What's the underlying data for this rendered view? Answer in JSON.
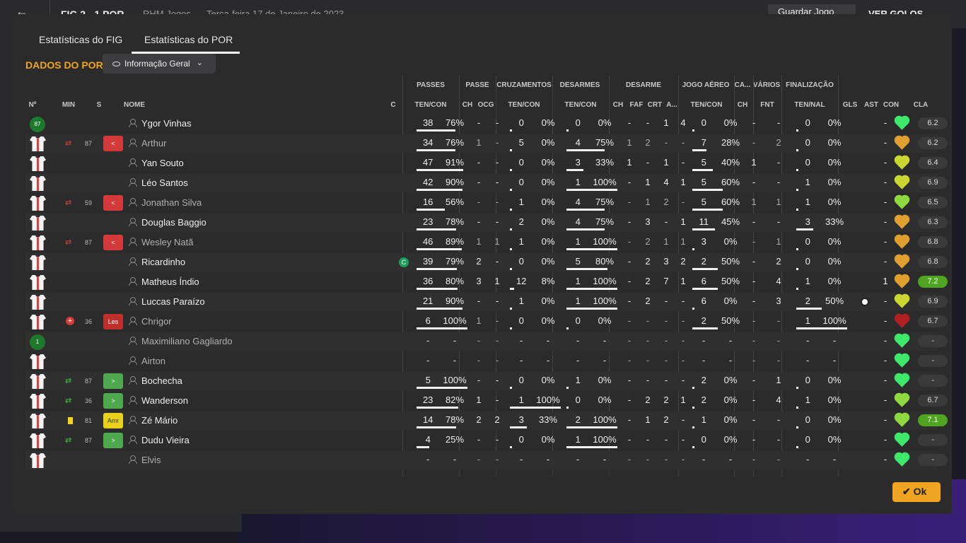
{
  "topbar": {
    "back": "←",
    "score": "FIG  2 - 1  POR",
    "competition": "RHM Jogos",
    "date": "Terça-feira 17 de Janeiro de 2023",
    "save": "Guardar Jogo",
    "goals": "VER GOLOS"
  },
  "tabs": [
    {
      "label": "Estatísticas do FIG"
    },
    {
      "label": "Estatísticas do POR"
    }
  ],
  "title": "DADOS DO POR",
  "dropdown": {
    "label": "Informação Geral"
  },
  "groups": [
    "PASSES",
    "PASSE",
    "CRUZAMENTOS",
    "DESARMES",
    "DESARME",
    "JOGO AÉREO",
    "CA...",
    "VÁRIOS",
    "FINALIZAÇÃO"
  ],
  "cols": {
    "num": "Nº",
    "min": "MIN",
    "s": "S",
    "name": "NOME",
    "c": "C",
    "passes": "TEN/CON",
    "passe_ch": "CH",
    "passe_ocg": "OCG",
    "cruz": "TEN/CON",
    "desarmes": "TEN/CON",
    "des_ch": "CH",
    "des_faf": "FAF",
    "des_crt": "CRT",
    "des_a": "A...",
    "aereo": "TEN/CON",
    "ca_ch": "CH",
    "varios_fnt": "FNT",
    "final": "TEN/NAL",
    "gls": "GLS",
    "ast": "AST",
    "con": "CON",
    "cla": "CLA"
  },
  "players": [
    {
      "shirt": "g",
      "num": "87",
      "sub": "",
      "min": "",
      "badge": "",
      "name": "Ygor Vinhas",
      "dim": false,
      "cap": "",
      "p": [
        "38",
        "76%"
      ],
      "pf": 0.76,
      "ch": "-",
      "ocg": "-",
      "cr": [
        "0",
        "0%"
      ],
      "crf": 0,
      "de": [
        "0",
        "0%"
      ],
      "def": 0,
      "dch": "-",
      "faf": "-",
      "crt": "1",
      "a": "4",
      "ae": [
        "0",
        "0%"
      ],
      "aef": 0,
      "cach": "-",
      "fnt": "-",
      "fi": [
        "0",
        "0%"
      ],
      "fif": 0,
      "gls": "",
      "ast": "-",
      "con": "#3ee86a",
      "cla": "6.2",
      "hi": false
    },
    {
      "shirt": "w",
      "num": "",
      "sub": "out",
      "min": "87",
      "badge": "red",
      "name": "Arthur",
      "dim": true,
      "cap": "",
      "p": [
        "34",
        "76%"
      ],
      "pf": 0.76,
      "ch": "1",
      "ocg": "-",
      "cr": [
        "5",
        "0%"
      ],
      "crf": 0,
      "de": [
        "4",
        "75%"
      ],
      "def": 0.75,
      "dch": "1",
      "faf": "2",
      "crt": "-",
      "a": "-",
      "ae": [
        "7",
        "28%"
      ],
      "aef": 0.28,
      "cach": "-",
      "fnt": "2",
      "fi": [
        "0",
        "0%"
      ],
      "fif": 0,
      "gls": "",
      "ast": "-",
      "con": "#e0a030",
      "cla": "6.2",
      "hi": false
    },
    {
      "shirt": "w",
      "num": "",
      "sub": "",
      "min": "",
      "badge": "",
      "name": "Yan Souto",
      "dim": false,
      "cap": "",
      "p": [
        "47",
        "91%"
      ],
      "pf": 0.91,
      "ch": "-",
      "ocg": "-",
      "cr": [
        "0",
        "0%"
      ],
      "crf": 0,
      "de": [
        "3",
        "33%"
      ],
      "def": 0.33,
      "dch": "1",
      "faf": "-",
      "crt": "1",
      "a": "-",
      "ae": [
        "5",
        "40%"
      ],
      "aef": 0.4,
      "cach": "1",
      "fnt": "-",
      "fi": [
        "0",
        "0%"
      ],
      "fif": 0,
      "gls": "",
      "ast": "-",
      "con": "#c8d830",
      "cla": "6.4",
      "hi": false
    },
    {
      "shirt": "w",
      "num": "",
      "sub": "",
      "min": "",
      "badge": "",
      "name": "Léo Santos",
      "dim": false,
      "cap": "",
      "p": [
        "42",
        "90%"
      ],
      "pf": 0.9,
      "ch": "-",
      "ocg": "-",
      "cr": [
        "0",
        "0%"
      ],
      "crf": 0,
      "de": [
        "1",
        "100%"
      ],
      "def": 1,
      "dch": "-",
      "faf": "1",
      "crt": "4",
      "a": "1",
      "ae": [
        "5",
        "60%"
      ],
      "aef": 0.6,
      "cach": "-",
      "fnt": "-",
      "fi": [
        "1",
        "0%"
      ],
      "fif": 0,
      "gls": "",
      "ast": "-",
      "con": "#c8d830",
      "cla": "6.9",
      "hi": false
    },
    {
      "shirt": "w",
      "num": "",
      "sub": "out",
      "min": "59",
      "badge": "red",
      "name": "Jonathan Silva",
      "dim": true,
      "cap": "",
      "p": [
        "16",
        "56%"
      ],
      "pf": 0.56,
      "ch": "-",
      "ocg": "-",
      "cr": [
        "1",
        "0%"
      ],
      "crf": 0,
      "de": [
        "4",
        "75%"
      ],
      "def": 0.75,
      "dch": "-",
      "faf": "1",
      "crt": "2",
      "a": "-",
      "ae": [
        "5",
        "60%"
      ],
      "aef": 0.6,
      "cach": "1",
      "fnt": "1",
      "fi": [
        "1",
        "0%"
      ],
      "fif": 0,
      "gls": "",
      "ast": "-",
      "con": "#8ed840",
      "cla": "6.5",
      "hi": false
    },
    {
      "shirt": "w",
      "num": "",
      "sub": "",
      "min": "",
      "badge": "",
      "name": "Douglas Baggio",
      "dim": false,
      "cap": "",
      "p": [
        "23",
        "78%"
      ],
      "pf": 0.78,
      "ch": "-",
      "ocg": "-",
      "cr": [
        "2",
        "0%"
      ],
      "crf": 0,
      "de": [
        "4",
        "75%"
      ],
      "def": 0.75,
      "dch": "-",
      "faf": "3",
      "crt": "-",
      "a": "1",
      "ae": [
        "11",
        "45%"
      ],
      "aef": 0.45,
      "cach": "-",
      "fnt": "-",
      "fi": [
        "3",
        "33%"
      ],
      "fif": 0.33,
      "gls": "",
      "ast": "-",
      "con": "#e0a030",
      "cla": "6.3",
      "hi": false
    },
    {
      "shirt": "w",
      "num": "",
      "sub": "out",
      "min": "87",
      "badge": "red",
      "name": "Wesley Natã",
      "dim": true,
      "cap": "",
      "p": [
        "46",
        "89%"
      ],
      "pf": 0.89,
      "ch": "1",
      "ocg": "1",
      "cr": [
        "1",
        "0%"
      ],
      "crf": 0,
      "de": [
        "1",
        "100%"
      ],
      "def": 1,
      "dch": "-",
      "faf": "2",
      "crt": "1",
      "a": "1",
      "ae": [
        "3",
        "0%"
      ],
      "aef": 0,
      "cach": "-",
      "fnt": "1",
      "fi": [
        "0",
        "0%"
      ],
      "fif": 0,
      "gls": "",
      "ast": "-",
      "con": "#e0a030",
      "cla": "6.8",
      "hi": false
    },
    {
      "shirt": "w",
      "num": "",
      "sub": "",
      "min": "",
      "badge": "",
      "name": "Ricardinho",
      "dim": false,
      "cap": "C",
      "p": [
        "39",
        "79%"
      ],
      "pf": 0.79,
      "ch": "2",
      "ocg": "-",
      "cr": [
        "0",
        "0%"
      ],
      "crf": 0,
      "de": [
        "5",
        "80%"
      ],
      "def": 0.8,
      "dch": "-",
      "faf": "2",
      "crt": "3",
      "a": "2",
      "ae": [
        "2",
        "50%"
      ],
      "aef": 0.5,
      "cach": "-",
      "fnt": "2",
      "fi": [
        "0",
        "0%"
      ],
      "fif": 0,
      "gls": "",
      "ast": "-",
      "con": "#e0a030",
      "cla": "6.8",
      "hi": false
    },
    {
      "shirt": "w",
      "num": "",
      "sub": "",
      "min": "",
      "badge": "",
      "name": "Matheus Índio",
      "dim": false,
      "cap": "",
      "p": [
        "36",
        "80%"
      ],
      "pf": 0.8,
      "ch": "3",
      "ocg": "1",
      "cr": [
        "12",
        "8%"
      ],
      "crf": 0.08,
      "de": [
        "1",
        "100%"
      ],
      "def": 1,
      "dch": "-",
      "faf": "2",
      "crt": "7",
      "a": "1",
      "ae": [
        "6",
        "50%"
      ],
      "aef": 0.5,
      "cach": "-",
      "fnt": "4",
      "fi": [
        "1",
        "0%"
      ],
      "fif": 0,
      "gls": "",
      "ast": "1",
      "con": "#e0a030",
      "cla": "7.2",
      "hi": true
    },
    {
      "shirt": "w",
      "num": "",
      "sub": "",
      "min": "",
      "badge": "",
      "name": "Luccas Paraízo",
      "dim": false,
      "cap": "",
      "p": [
        "21",
        "90%"
      ],
      "pf": 0.9,
      "ch": "-",
      "ocg": "-",
      "cr": [
        "1",
        "0%"
      ],
      "crf": 0,
      "de": [
        "1",
        "100%"
      ],
      "def": 1,
      "dch": "-",
      "faf": "2",
      "crt": "-",
      "a": "-",
      "ae": [
        "6",
        "0%"
      ],
      "aef": 0,
      "cach": "-",
      "fnt": "3",
      "fi": [
        "2",
        "50%"
      ],
      "fif": 0.5,
      "gls": "ball",
      "ast": "-",
      "con": "#c8d830",
      "cla": "6.9",
      "hi": false
    },
    {
      "shirt": "w",
      "num": "",
      "sub": "inj",
      "min": "36",
      "badge": "les",
      "name": "Chrigor",
      "dim": true,
      "cap": "",
      "p": [
        "6",
        "100%"
      ],
      "pf": 1,
      "ch": "1",
      "ocg": "-",
      "cr": [
        "0",
        "0%"
      ],
      "crf": 0,
      "de": [
        "0",
        "0%"
      ],
      "def": 0,
      "dch": "-",
      "faf": "-",
      "crt": "-",
      "a": "-",
      "ae": [
        "2",
        "50%"
      ],
      "aef": 0.5,
      "cach": "-",
      "fnt": "-",
      "fi": [
        "1",
        "100%"
      ],
      "fif": 1,
      "gls": "",
      "ast": "-",
      "con": "#b02020",
      "cla": "6.7",
      "hi": false
    },
    {
      "shirt": "g",
      "num": "1",
      "sub": "",
      "min": "",
      "badge": "",
      "name": "Maximiliano Gagliardo",
      "dim": true,
      "cap": "",
      "p": [
        "-",
        "-"
      ],
      "pf": 0,
      "ch": "-",
      "ocg": "-",
      "cr": [
        "-",
        "-"
      ],
      "crf": 0,
      "de": [
        "-",
        "-"
      ],
      "def": 0,
      "dch": "-",
      "faf": "-",
      "crt": "-",
      "a": "-",
      "ae": [
        "-",
        "-"
      ],
      "aef": 0,
      "cach": "-",
      "fnt": "-",
      "fi": [
        "-",
        "-"
      ],
      "fif": 0,
      "gls": "",
      "ast": "-",
      "con": "#3ee86a",
      "cla": "-",
      "hi": false
    },
    {
      "shirt": "w",
      "num": "",
      "sub": "",
      "min": "",
      "badge": "",
      "name": "Airton",
      "dim": true,
      "cap": "",
      "p": [
        "-",
        "-"
      ],
      "pf": 0,
      "ch": "-",
      "ocg": "-",
      "cr": [
        "-",
        "-"
      ],
      "crf": 0,
      "de": [
        "-",
        "-"
      ],
      "def": 0,
      "dch": "-",
      "faf": "-",
      "crt": "-",
      "a": "-",
      "ae": [
        "-",
        "-"
      ],
      "aef": 0,
      "cach": "-",
      "fnt": "-",
      "fi": [
        "-",
        "-"
      ],
      "fif": 0,
      "gls": "",
      "ast": "-",
      "con": "#3ee86a",
      "cla": "-",
      "hi": false
    },
    {
      "shirt": "w",
      "num": "",
      "sub": "in",
      "min": "87",
      "badge": "grn",
      "name": "Bochecha",
      "dim": false,
      "cap": "",
      "p": [
        "5",
        "100%"
      ],
      "pf": 1,
      "ch": "-",
      "ocg": "-",
      "cr": [
        "0",
        "0%"
      ],
      "crf": 0,
      "de": [
        "1",
        "0%"
      ],
      "def": 0,
      "dch": "-",
      "faf": "-",
      "crt": "-",
      "a": "-",
      "ae": [
        "2",
        "0%"
      ],
      "aef": 0,
      "cach": "-",
      "fnt": "1",
      "fi": [
        "0",
        "0%"
      ],
      "fif": 0,
      "gls": "",
      "ast": "-",
      "con": "#3ee86a",
      "cla": "-",
      "hi": false
    },
    {
      "shirt": "w",
      "num": "",
      "sub": "in",
      "min": "36",
      "badge": "grn",
      "name": "Wanderson",
      "dim": false,
      "cap": "",
      "p": [
        "23",
        "82%"
      ],
      "pf": 0.82,
      "ch": "1",
      "ocg": "-",
      "cr": [
        "1",
        "100%"
      ],
      "crf": 1,
      "de": [
        "0",
        "0%"
      ],
      "def": 0,
      "dch": "-",
      "faf": "2",
      "crt": "2",
      "a": "1",
      "ae": [
        "2",
        "0%"
      ],
      "aef": 0,
      "cach": "-",
      "fnt": "4",
      "fi": [
        "1",
        "0%"
      ],
      "fif": 0,
      "gls": "",
      "ast": "-",
      "con": "#8ed840",
      "cla": "6.7",
      "hi": false
    },
    {
      "shirt": "w",
      "num": "",
      "sub": "yc",
      "min": "81",
      "badge": "amr",
      "name": "Zé Mário",
      "dim": false,
      "cap": "",
      "p": [
        "14",
        "78%"
      ],
      "pf": 0.78,
      "ch": "2",
      "ocg": "2",
      "cr": [
        "3",
        "33%"
      ],
      "crf": 0.33,
      "de": [
        "2",
        "100%"
      ],
      "def": 1,
      "dch": "-",
      "faf": "1",
      "crt": "2",
      "a": "-",
      "ae": [
        "1",
        "0%"
      ],
      "aef": 0,
      "cach": "-",
      "fnt": "-",
      "fi": [
        "0",
        "0%"
      ],
      "fif": 0,
      "gls": "",
      "ast": "-",
      "con": "#8ed840",
      "cla": "7.1",
      "hi": true
    },
    {
      "shirt": "w",
      "num": "",
      "sub": "in",
      "min": "87",
      "badge": "grn",
      "name": "Dudu Vieira",
      "dim": false,
      "cap": "",
      "p": [
        "4",
        "25%"
      ],
      "pf": 0.25,
      "ch": "-",
      "ocg": "-",
      "cr": [
        "0",
        "0%"
      ],
      "crf": 0,
      "de": [
        "1",
        "100%"
      ],
      "def": 1,
      "dch": "-",
      "faf": "-",
      "crt": "-",
      "a": "-",
      "ae": [
        "0",
        "0%"
      ],
      "aef": 0,
      "cach": "-",
      "fnt": "-",
      "fi": [
        "0",
        "0%"
      ],
      "fif": 0,
      "gls": "",
      "ast": "-",
      "con": "#3ee86a",
      "cla": "-",
      "hi": false
    },
    {
      "shirt": "w",
      "num": "",
      "sub": "",
      "min": "",
      "badge": "",
      "name": "Elvis",
      "dim": true,
      "cap": "",
      "p": [
        "-",
        "-"
      ],
      "pf": 0,
      "ch": "-",
      "ocg": "-",
      "cr": [
        "-",
        "-"
      ],
      "crf": 0,
      "de": [
        "-",
        "-"
      ],
      "def": 0,
      "dch": "-",
      "faf": "-",
      "crt": "-",
      "a": "-",
      "ae": [
        "-",
        "-"
      ],
      "aef": 0,
      "cach": "-",
      "fnt": "-",
      "fi": [
        "-",
        "-"
      ],
      "fif": 0,
      "gls": "",
      "ast": "-",
      "con": "#3ee86a",
      "cla": "-",
      "hi": false
    }
  ],
  "badge_text": {
    "red": "<",
    "grn": ">",
    "les": "Les",
    "amr": "Amr"
  },
  "ok": "✔ Ok"
}
